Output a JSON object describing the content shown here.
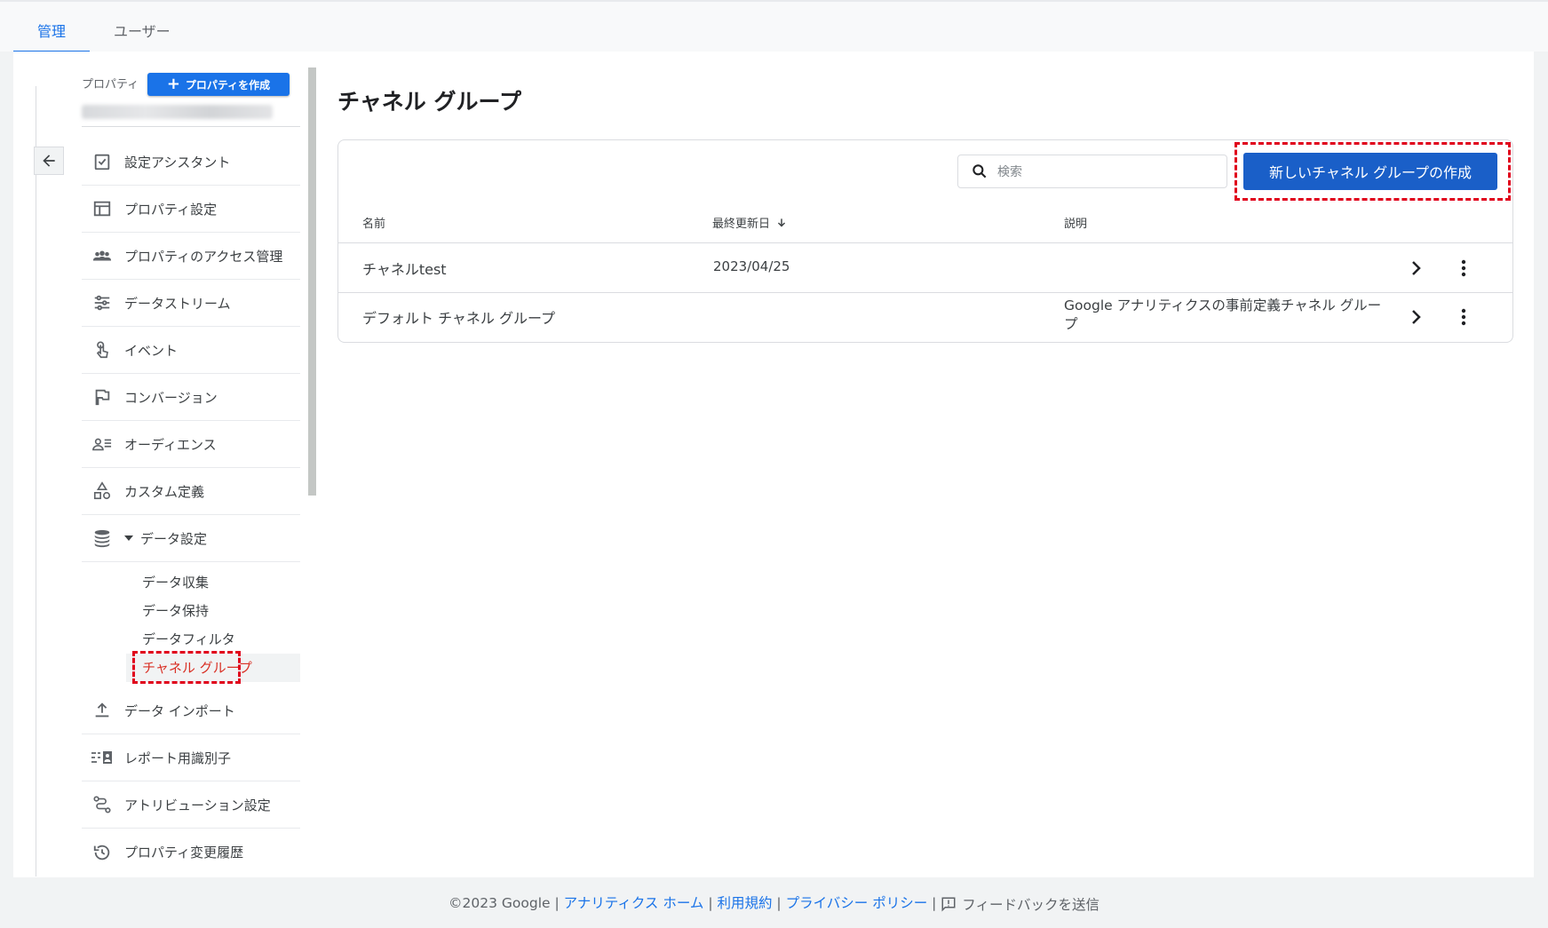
{
  "tabs": [
    {
      "label": "管理",
      "active": true
    },
    {
      "label": "ユーザー",
      "active": false
    }
  ],
  "sidebar": {
    "property_label": "プロパティ",
    "create_property_label": "プロパティを作成",
    "items": [
      {
        "label": "設定アシスタント",
        "icon": "checklist-icon"
      },
      {
        "label": "プロパティ設定",
        "icon": "layout-icon"
      },
      {
        "label": "プロパティのアクセス管理",
        "icon": "people-icon"
      },
      {
        "label": "データストリーム",
        "icon": "stream-icon"
      },
      {
        "label": "イベント",
        "icon": "touch-icon"
      },
      {
        "label": "コンバージョン",
        "icon": "flag-icon"
      },
      {
        "label": "オーディエンス",
        "icon": "audience-icon"
      },
      {
        "label": "カスタム定義",
        "icon": "shapes-icon"
      },
      {
        "label": "データ設定",
        "icon": "database-icon",
        "expanded": true
      },
      {
        "label": "データ インポート",
        "icon": "upload-icon"
      },
      {
        "label": "レポート用識別子",
        "icon": "identifier-icon"
      },
      {
        "label": "アトリビューション設定",
        "icon": "attribution-icon"
      },
      {
        "label": "プロパティ変更履歴",
        "icon": "history-icon"
      }
    ],
    "sub_items": [
      {
        "label": "データ収集",
        "active": false
      },
      {
        "label": "データ保持",
        "active": false
      },
      {
        "label": "データフィルタ",
        "active": false
      },
      {
        "label": "チャネル グループ",
        "active": true
      }
    ]
  },
  "main": {
    "title": "チャネル グループ",
    "search_placeholder": "検索",
    "new_button_label": "新しいチャネル グループの作成",
    "columns": {
      "name": "名前",
      "updated": "最終更新日",
      "description": "説明"
    },
    "rows": [
      {
        "name": "チャネルtest",
        "updated": "2023/04/25",
        "description": ""
      },
      {
        "name": "デフォルト チャネル グループ",
        "updated": "",
        "description": "Google アナリティクスの事前定義チャネル グループ"
      }
    ]
  },
  "footer": {
    "copyright": "©2023 Google",
    "home_link": "アナリティクス ホーム",
    "terms_link": "利用規約",
    "privacy_link": "プライバシー ポリシー",
    "feedback": "フィードバックを送信"
  },
  "colors": {
    "accent": "#1a73e8",
    "button": "#1a5fc8",
    "highlight": "#e0001b"
  }
}
